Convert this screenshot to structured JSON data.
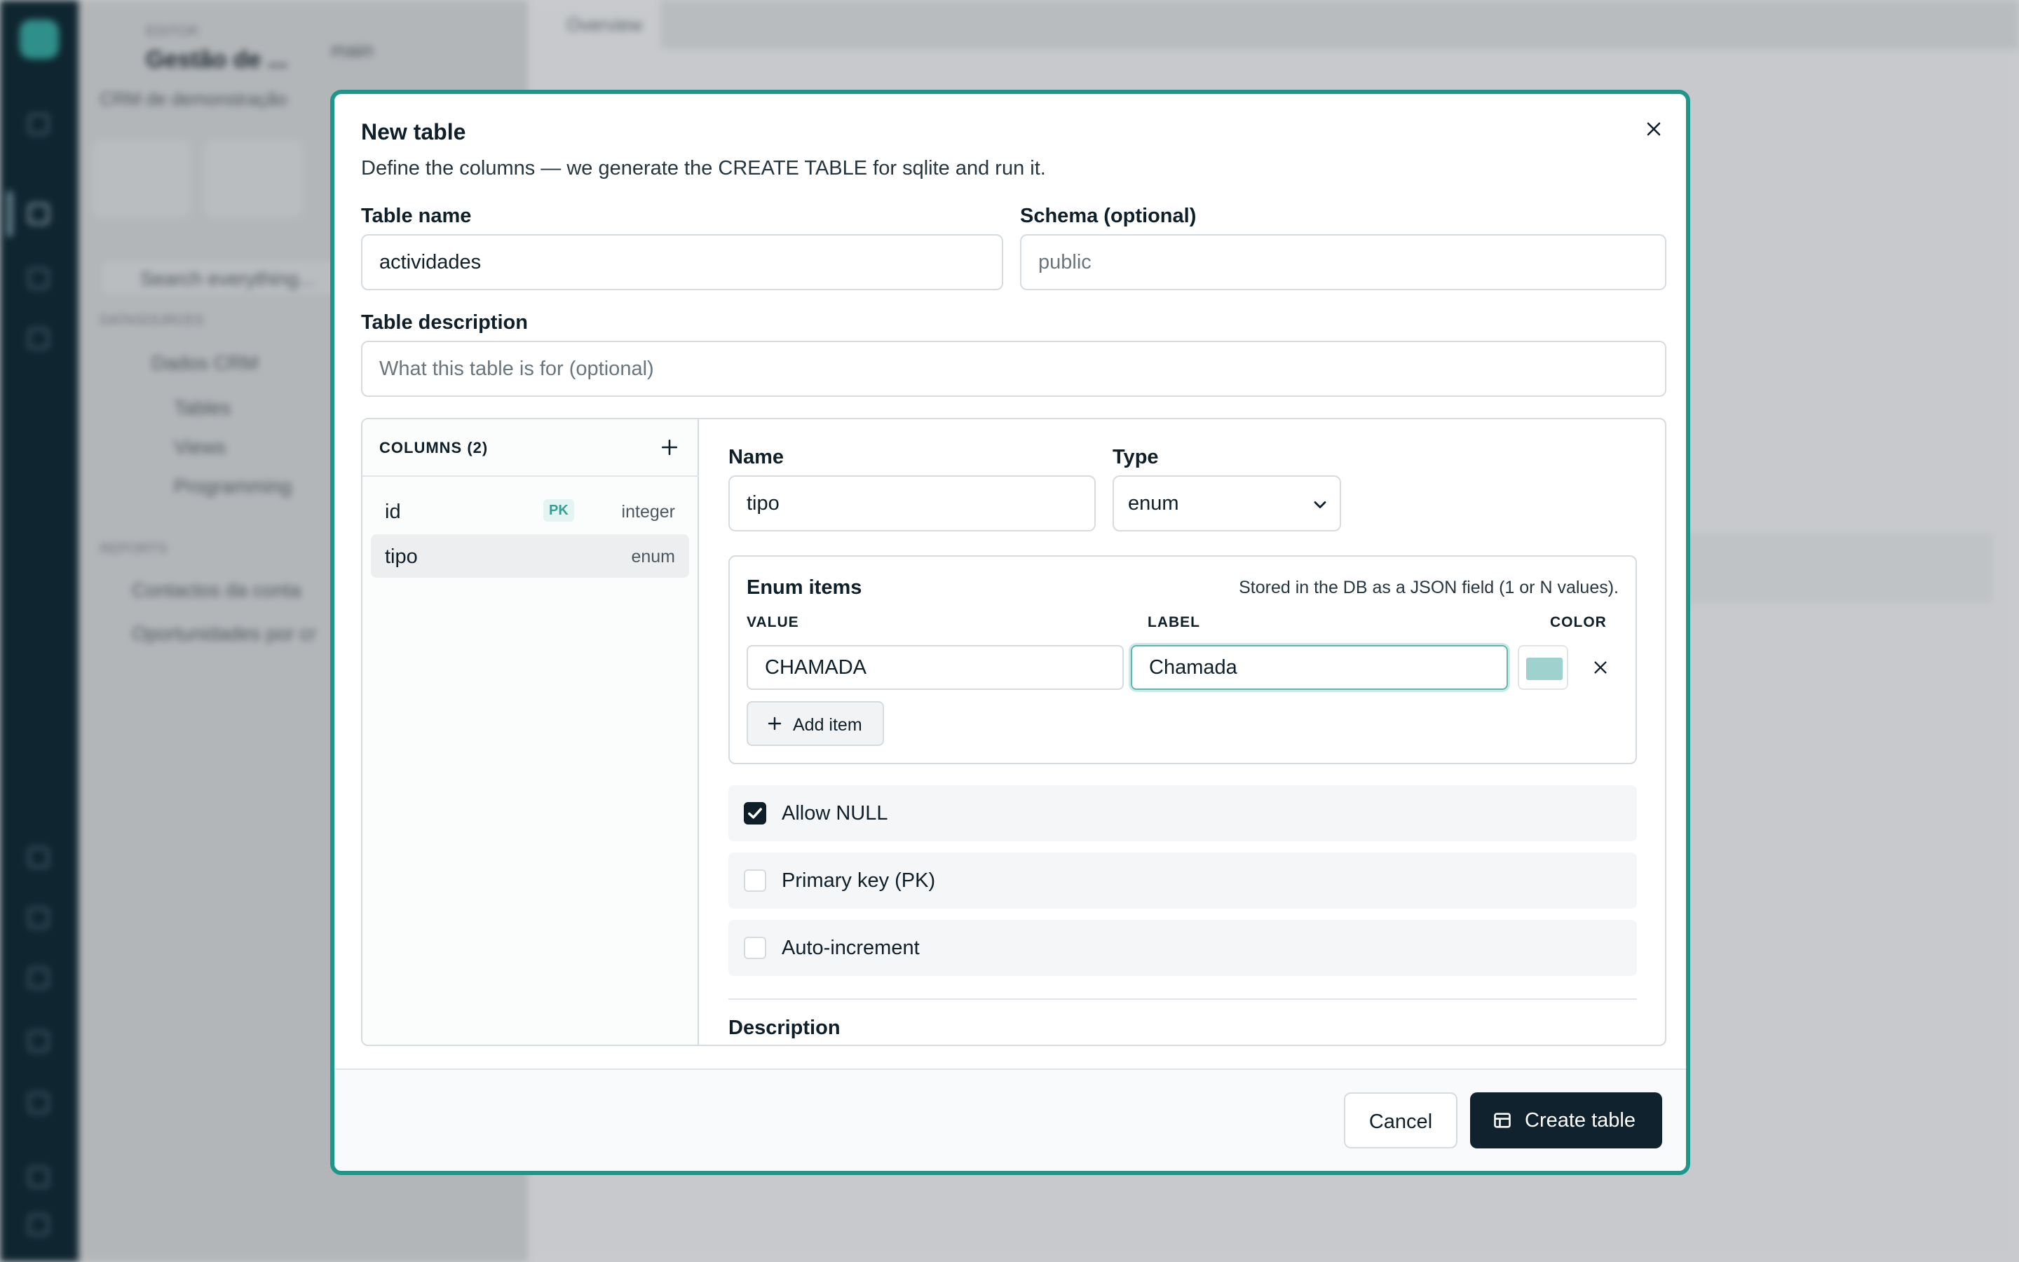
{
  "background": {
    "sidebar_caption": "EDITOR",
    "sidebar_title": "Gestão de ...",
    "branch_label": "main",
    "sidebar_subtitle": "CRM de demonstração",
    "search_placeholder": "Search everything...",
    "section_datasources": "DATASOURCES",
    "datasource_name": "Dados CRM",
    "tree_items": [
      "Tables",
      "Views",
      "Programming"
    ],
    "section_reports": "REPORTS",
    "report_items": [
      "Contactos da conta",
      "Oportunidades por cr"
    ],
    "main_tab": "Overview"
  },
  "modal": {
    "title": "New table",
    "subtitle": "Define the columns — we generate the CREATE TABLE for sqlite and run it.",
    "table_name_label": "Table name",
    "table_name_value": "actividades",
    "schema_label": "Schema (optional)",
    "schema_placeholder": "public",
    "description_label": "Table description",
    "description_placeholder": "What this table is for (optional)",
    "columns": {
      "header": "COLUMNS (2)",
      "items": [
        {
          "name": "id",
          "badge": "PK",
          "type": "integer"
        },
        {
          "name": "tipo",
          "badge": "",
          "type": "enum"
        }
      ]
    },
    "editor": {
      "name_label": "Name",
      "name_value": "tipo",
      "type_label": "Type",
      "type_value": "enum",
      "enum_title": "Enum items",
      "enum_note": "Stored in the DB as a JSON field (1 or N values).",
      "value_header": "VALUE",
      "label_header": "LABEL",
      "color_header": "COLOR",
      "enum_items": [
        {
          "value": "CHAMADA",
          "label": "Chamada",
          "color": "#9fd2cf"
        }
      ],
      "add_item_label": "Add item",
      "options": [
        {
          "label": "Allow NULL",
          "checked": true
        },
        {
          "label": "Primary key (PK)",
          "checked": false
        },
        {
          "label": "Auto-increment",
          "checked": false
        }
      ],
      "description_label": "Description"
    },
    "footer": {
      "cancel_label": "Cancel",
      "create_label": "Create table"
    }
  },
  "colors": {
    "accent": "#1f968c",
    "primary_button": "#10222e",
    "enum_color": "#9fd2cf"
  },
  "icons": [
    "close-icon",
    "plus-icon",
    "chevron-down-icon",
    "check-icon",
    "table-icon"
  ]
}
